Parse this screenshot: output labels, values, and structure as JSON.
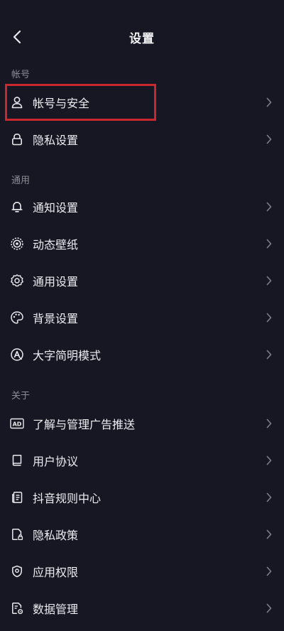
{
  "header": {
    "title": "设置"
  },
  "sections": [
    {
      "label": "帐号",
      "items": [
        {
          "label": "帐号与安全",
          "icon": "person-icon"
        },
        {
          "label": "隐私设置",
          "icon": "lock-icon"
        }
      ]
    },
    {
      "label": "通用",
      "items": [
        {
          "label": "通知设置",
          "icon": "bell-icon"
        },
        {
          "label": "动态壁纸",
          "icon": "wallpaper-icon"
        },
        {
          "label": "通用设置",
          "icon": "gear-icon"
        },
        {
          "label": "背景设置",
          "icon": "palette-icon"
        },
        {
          "label": "大字简明模式",
          "icon": "large-font-icon"
        }
      ]
    },
    {
      "label": "关于",
      "items": [
        {
          "label": "了解与管理广告推送",
          "icon": "ad-icon",
          "icon_text": "AD"
        },
        {
          "label": "用户协议",
          "icon": "book-icon"
        },
        {
          "label": "抖音规则中心",
          "icon": "rules-doc-icon"
        },
        {
          "label": "隐私政策",
          "icon": "privacy-doc-icon"
        },
        {
          "label": "应用权限",
          "icon": "location-shield-icon"
        },
        {
          "label": "数据管理",
          "icon": "data-file-icon"
        }
      ]
    }
  ],
  "colors": {
    "background": "#161722",
    "highlight": "#c8272d"
  }
}
